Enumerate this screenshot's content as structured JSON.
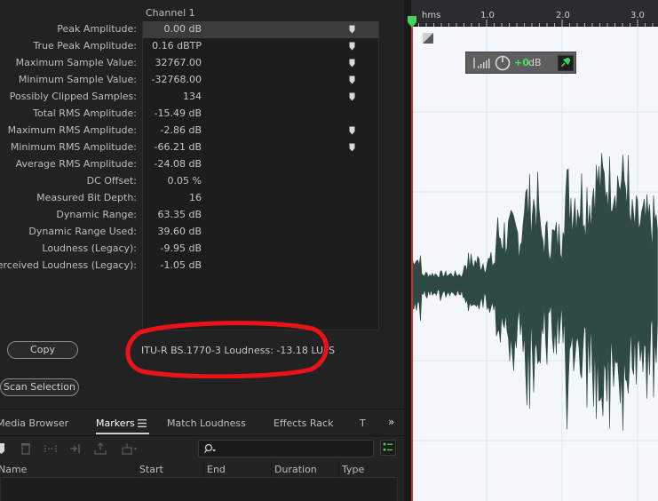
{
  "stats": {
    "channel_header": "Channel 1",
    "rows": [
      {
        "label": "Peak Amplitude:",
        "value": "0.00 dB",
        "pin": true
      },
      {
        "label": "True Peak Amplitude:",
        "value": "0.16 dBTP",
        "pin": true
      },
      {
        "label": "Maximum Sample Value:",
        "value": "32767.00",
        "pin": true
      },
      {
        "label": "Minimum Sample Value:",
        "value": "-32768.00",
        "pin": true
      },
      {
        "label": "Possibly Clipped Samples:",
        "value": "134",
        "pin": true
      },
      {
        "label": "Total RMS Amplitude:",
        "value": "-15.49 dB",
        "pin": false
      },
      {
        "label": "Maximum RMS Amplitude:",
        "value": "-2.86 dB",
        "pin": true
      },
      {
        "label": "Minimum RMS Amplitude:",
        "value": "-66.21 dB",
        "pin": true
      },
      {
        "label": "Average RMS Amplitude:",
        "value": "-24.08 dB",
        "pin": false
      },
      {
        "label": "DC Offset:",
        "value": "0.05 %",
        "pin": false
      },
      {
        "label": "Measured Bit Depth:",
        "value": "16",
        "pin": false
      },
      {
        "label": "Dynamic Range:",
        "value": "63.35 dB",
        "pin": false
      },
      {
        "label": "Dynamic Range Used:",
        "value": "39.60 dB",
        "pin": false
      },
      {
        "label": "Loudness (Legacy):",
        "value": "-9.95 dB",
        "pin": false
      },
      {
        "label": "Perceived Loudness (Legacy):",
        "value": "-1.05 dB",
        "pin": false
      }
    ],
    "copy_label": "Copy",
    "loudness_text": "ITU-R BS.1770-3 Loudness:  -13.18 LUFS",
    "scan_label": "Scan Selection",
    "annotation_color": "#e8141a"
  },
  "tabs": {
    "items": [
      "Media Browser",
      "Markers",
      "Match Loudness",
      "Effects Rack",
      "T"
    ],
    "active": "Markers",
    "markers_menu_icon": "hamburger-icon",
    "overflow": "»"
  },
  "markers_table": {
    "columns": [
      "Name",
      "Start",
      "End",
      "Duration",
      "Type"
    ]
  },
  "waveform": {
    "ruler_labels": [
      "hms",
      "1.0",
      "2.0",
      "3.0"
    ],
    "hud_value": "+0",
    "hud_unit": "dB",
    "wave_color": "#2f4a42",
    "background_color": "#f4f7fb"
  }
}
